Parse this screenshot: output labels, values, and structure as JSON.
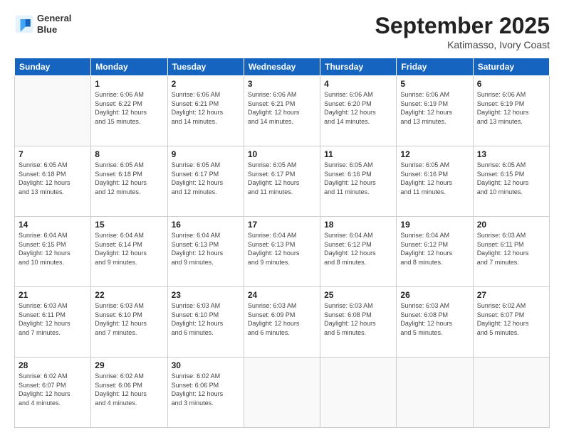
{
  "header": {
    "logo_line1": "General",
    "logo_line2": "Blue",
    "month": "September 2025",
    "location": "Katimasso, Ivory Coast"
  },
  "days_of_week": [
    "Sunday",
    "Monday",
    "Tuesday",
    "Wednesday",
    "Thursday",
    "Friday",
    "Saturday"
  ],
  "weeks": [
    [
      {
        "day": "",
        "info": ""
      },
      {
        "day": "1",
        "info": "Sunrise: 6:06 AM\nSunset: 6:22 PM\nDaylight: 12 hours\nand 15 minutes."
      },
      {
        "day": "2",
        "info": "Sunrise: 6:06 AM\nSunset: 6:21 PM\nDaylight: 12 hours\nand 14 minutes."
      },
      {
        "day": "3",
        "info": "Sunrise: 6:06 AM\nSunset: 6:21 PM\nDaylight: 12 hours\nand 14 minutes."
      },
      {
        "day": "4",
        "info": "Sunrise: 6:06 AM\nSunset: 6:20 PM\nDaylight: 12 hours\nand 14 minutes."
      },
      {
        "day": "5",
        "info": "Sunrise: 6:06 AM\nSunset: 6:19 PM\nDaylight: 12 hours\nand 13 minutes."
      },
      {
        "day": "6",
        "info": "Sunrise: 6:06 AM\nSunset: 6:19 PM\nDaylight: 12 hours\nand 13 minutes."
      }
    ],
    [
      {
        "day": "7",
        "info": "Sunrise: 6:05 AM\nSunset: 6:18 PM\nDaylight: 12 hours\nand 13 minutes."
      },
      {
        "day": "8",
        "info": "Sunrise: 6:05 AM\nSunset: 6:18 PM\nDaylight: 12 hours\nand 12 minutes."
      },
      {
        "day": "9",
        "info": "Sunrise: 6:05 AM\nSunset: 6:17 PM\nDaylight: 12 hours\nand 12 minutes."
      },
      {
        "day": "10",
        "info": "Sunrise: 6:05 AM\nSunset: 6:17 PM\nDaylight: 12 hours\nand 11 minutes."
      },
      {
        "day": "11",
        "info": "Sunrise: 6:05 AM\nSunset: 6:16 PM\nDaylight: 12 hours\nand 11 minutes."
      },
      {
        "day": "12",
        "info": "Sunrise: 6:05 AM\nSunset: 6:16 PM\nDaylight: 12 hours\nand 11 minutes."
      },
      {
        "day": "13",
        "info": "Sunrise: 6:05 AM\nSunset: 6:15 PM\nDaylight: 12 hours\nand 10 minutes."
      }
    ],
    [
      {
        "day": "14",
        "info": "Sunrise: 6:04 AM\nSunset: 6:15 PM\nDaylight: 12 hours\nand 10 minutes."
      },
      {
        "day": "15",
        "info": "Sunrise: 6:04 AM\nSunset: 6:14 PM\nDaylight: 12 hours\nand 9 minutes."
      },
      {
        "day": "16",
        "info": "Sunrise: 6:04 AM\nSunset: 6:13 PM\nDaylight: 12 hours\nand 9 minutes."
      },
      {
        "day": "17",
        "info": "Sunrise: 6:04 AM\nSunset: 6:13 PM\nDaylight: 12 hours\nand 9 minutes."
      },
      {
        "day": "18",
        "info": "Sunrise: 6:04 AM\nSunset: 6:12 PM\nDaylight: 12 hours\nand 8 minutes."
      },
      {
        "day": "19",
        "info": "Sunrise: 6:04 AM\nSunset: 6:12 PM\nDaylight: 12 hours\nand 8 minutes."
      },
      {
        "day": "20",
        "info": "Sunrise: 6:03 AM\nSunset: 6:11 PM\nDaylight: 12 hours\nand 7 minutes."
      }
    ],
    [
      {
        "day": "21",
        "info": "Sunrise: 6:03 AM\nSunset: 6:11 PM\nDaylight: 12 hours\nand 7 minutes."
      },
      {
        "day": "22",
        "info": "Sunrise: 6:03 AM\nSunset: 6:10 PM\nDaylight: 12 hours\nand 7 minutes."
      },
      {
        "day": "23",
        "info": "Sunrise: 6:03 AM\nSunset: 6:10 PM\nDaylight: 12 hours\nand 6 minutes."
      },
      {
        "day": "24",
        "info": "Sunrise: 6:03 AM\nSunset: 6:09 PM\nDaylight: 12 hours\nand 6 minutes."
      },
      {
        "day": "25",
        "info": "Sunrise: 6:03 AM\nSunset: 6:08 PM\nDaylight: 12 hours\nand 5 minutes."
      },
      {
        "day": "26",
        "info": "Sunrise: 6:03 AM\nSunset: 6:08 PM\nDaylight: 12 hours\nand 5 minutes."
      },
      {
        "day": "27",
        "info": "Sunrise: 6:02 AM\nSunset: 6:07 PM\nDaylight: 12 hours\nand 5 minutes."
      }
    ],
    [
      {
        "day": "28",
        "info": "Sunrise: 6:02 AM\nSunset: 6:07 PM\nDaylight: 12 hours\nand 4 minutes."
      },
      {
        "day": "29",
        "info": "Sunrise: 6:02 AM\nSunset: 6:06 PM\nDaylight: 12 hours\nand 4 minutes."
      },
      {
        "day": "30",
        "info": "Sunrise: 6:02 AM\nSunset: 6:06 PM\nDaylight: 12 hours\nand 3 minutes."
      },
      {
        "day": "",
        "info": ""
      },
      {
        "day": "",
        "info": ""
      },
      {
        "day": "",
        "info": ""
      },
      {
        "day": "",
        "info": ""
      }
    ]
  ]
}
